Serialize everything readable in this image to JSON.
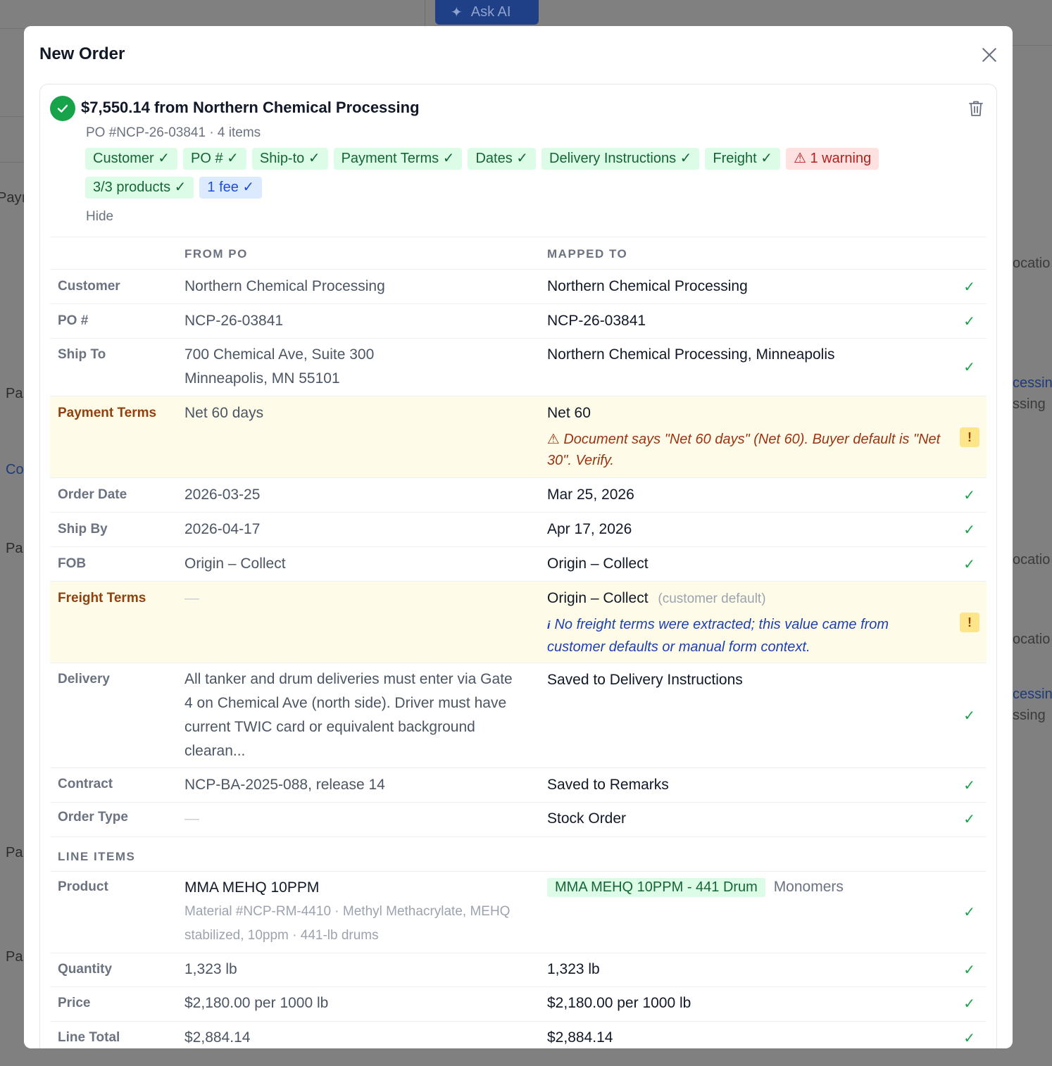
{
  "background": {
    "ask_ai_label": "Ask AI",
    "fragments": [
      "Payı",
      "Pa",
      "Co",
      "Pa",
      "Pa",
      "Pa",
      "ocatio",
      "cessin",
      "ssing",
      "ocatio",
      "ocatio",
      "cessin",
      "ssing"
    ]
  },
  "modal": {
    "title": "New Order",
    "summary": "$7,550.14 from Northern Chemical Processing",
    "subline": "PO #NCP-26-03841 · 4 items",
    "chips": [
      {
        "label": "Customer ✓",
        "kind": "ok"
      },
      {
        "label": "PO # ✓",
        "kind": "ok"
      },
      {
        "label": "Ship-to ✓",
        "kind": "ok"
      },
      {
        "label": "Payment Terms ✓",
        "kind": "ok"
      },
      {
        "label": "Dates ✓",
        "kind": "ok"
      },
      {
        "label": "Delivery Instructions ✓",
        "kind": "ok"
      },
      {
        "label": "Freight ✓",
        "kind": "ok"
      },
      {
        "label": "⚠ 1 warning",
        "kind": "warn"
      },
      {
        "label": "3/3 products ✓",
        "kind": "ok"
      },
      {
        "label": "1 fee ✓",
        "kind": "fee"
      }
    ],
    "hide_label": "Hide",
    "headers": {
      "from": "FROM PO",
      "to": "MAPPED TO"
    },
    "rows": {
      "customer": {
        "label": "Customer",
        "from": "Northern Chemical Processing",
        "to": "Northern Chemical Processing"
      },
      "po": {
        "label": "PO #",
        "from": "NCP-26-03841",
        "to": "NCP-26-03841"
      },
      "ship_to": {
        "label": "Ship To",
        "from_line1": "700 Chemical Ave, Suite 300",
        "from_line2": "Minneapolis, MN 55101",
        "to": "Northern Chemical Processing, Minneapolis"
      },
      "payment_terms": {
        "label": "Payment Terms",
        "from": "Net 60 days",
        "to": "Net 60",
        "note": "⚠ Document says \"Net 60 days\" (Net 60). Buyer default is \"Net 30\". Verify."
      },
      "order_date": {
        "label": "Order Date",
        "from": "2026-03-25",
        "to": "Mar 25, 2026"
      },
      "ship_by": {
        "label": "Ship By",
        "from": "2026-04-17",
        "to": "Apr 17, 2026"
      },
      "fob": {
        "label": "FOB",
        "from": "Origin – Collect",
        "to": "Origin – Collect"
      },
      "freight_terms": {
        "label": "Freight Terms",
        "from": "—",
        "to": "Origin – Collect",
        "to_suffix": "(customer default)",
        "note_icon": "i",
        "note": "No freight terms were extracted; this value came from customer defaults or manual form context."
      },
      "delivery": {
        "label": "Delivery",
        "from": "All tanker and drum deliveries must enter via Gate 4 on Chemical Ave (north side). Driver must have current TWIC card or equivalent background clearan...",
        "to": "Saved to Delivery Instructions"
      },
      "contract": {
        "label": "Contract",
        "from": "NCP-BA-2025-088, release 14",
        "to": "Saved to Remarks"
      },
      "order_type": {
        "label": "Order Type",
        "from": "—",
        "to": "Stock Order"
      }
    },
    "line_items_header": "LINE ITEMS",
    "line_item": {
      "product_label": "Product",
      "product_name": "MMA MEHQ 10PPM",
      "product_desc": "Material #NCP-RM-4410 · Methyl Methacrylate, MEHQ stabilized, 10ppm · 441-lb drums",
      "mapped_product": "MMA MEHQ 10PPM - 441 Drum",
      "mapped_category": "Monomers",
      "quantity_label": "Quantity",
      "quantity_from": "1,323 lb",
      "quantity_to": "1,323 lb",
      "price_label": "Price",
      "price_from": "$2,180.00 per 1000 lb",
      "price_to": "$2,180.00 per 1000 lb",
      "total_label": "Line Total",
      "total_from": "$2,884.14",
      "total_to": "$2,884.14"
    },
    "check": "✓",
    "exclaim": "!"
  }
}
